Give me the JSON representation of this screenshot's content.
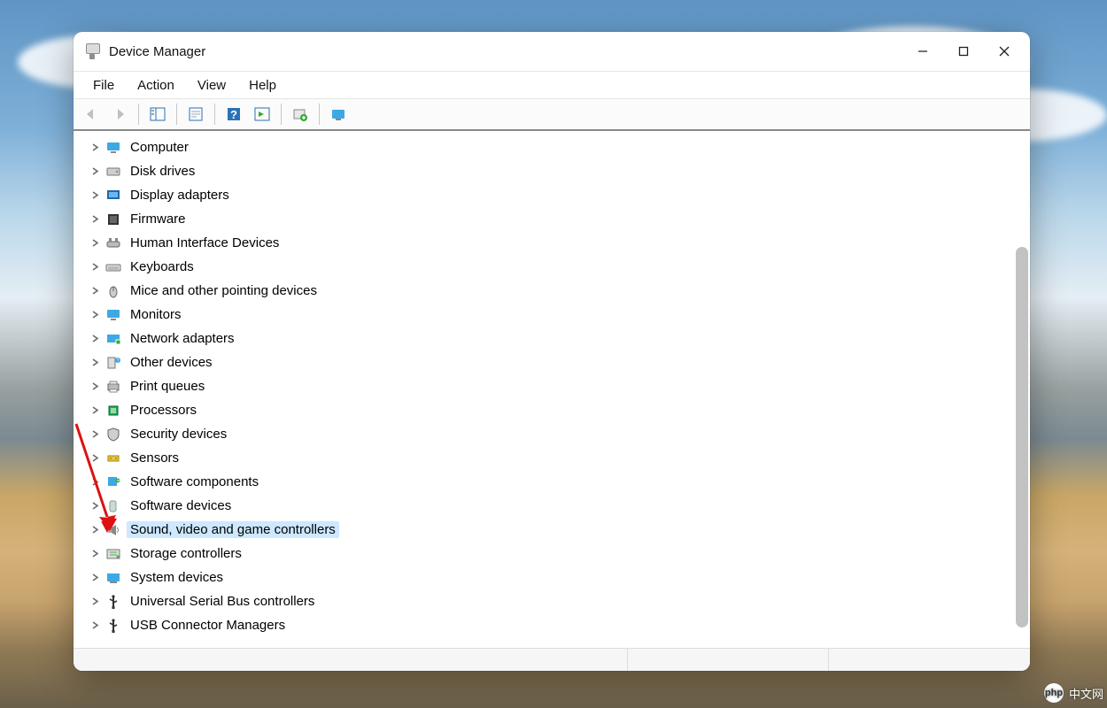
{
  "window": {
    "title": "Device Manager"
  },
  "menu": {
    "file": "File",
    "action": "Action",
    "view": "View",
    "help": "Help"
  },
  "tree": {
    "items": [
      {
        "label": "Computer",
        "icon": "monitor",
        "selected": false
      },
      {
        "label": "Disk drives",
        "icon": "disk",
        "selected": false
      },
      {
        "label": "Display adapters",
        "icon": "display",
        "selected": false
      },
      {
        "label": "Firmware",
        "icon": "chip",
        "selected": false
      },
      {
        "label": "Human Interface Devices",
        "icon": "hid",
        "selected": false
      },
      {
        "label": "Keyboards",
        "icon": "keyboard",
        "selected": false
      },
      {
        "label": "Mice and other pointing devices",
        "icon": "mouse",
        "selected": false
      },
      {
        "label": "Monitors",
        "icon": "monitor",
        "selected": false
      },
      {
        "label": "Network adapters",
        "icon": "network",
        "selected": false
      },
      {
        "label": "Other devices",
        "icon": "other",
        "selected": false
      },
      {
        "label": "Print queues",
        "icon": "printer",
        "selected": false
      },
      {
        "label": "Processors",
        "icon": "cpu",
        "selected": false
      },
      {
        "label": "Security devices",
        "icon": "shield",
        "selected": false
      },
      {
        "label": "Sensors",
        "icon": "sensor",
        "selected": false
      },
      {
        "label": "Software components",
        "icon": "puzzle",
        "selected": false
      },
      {
        "label": "Software devices",
        "icon": "softdev",
        "selected": false
      },
      {
        "label": "Sound, video and game controllers",
        "icon": "speaker",
        "selected": true
      },
      {
        "label": "Storage controllers",
        "icon": "storage",
        "selected": false
      },
      {
        "label": "System devices",
        "icon": "system",
        "selected": false
      },
      {
        "label": "Universal Serial Bus controllers",
        "icon": "usb",
        "selected": false
      },
      {
        "label": "USB Connector Managers",
        "icon": "usb",
        "selected": false
      }
    ]
  },
  "watermark": {
    "logo": "php",
    "text": "中文网"
  }
}
